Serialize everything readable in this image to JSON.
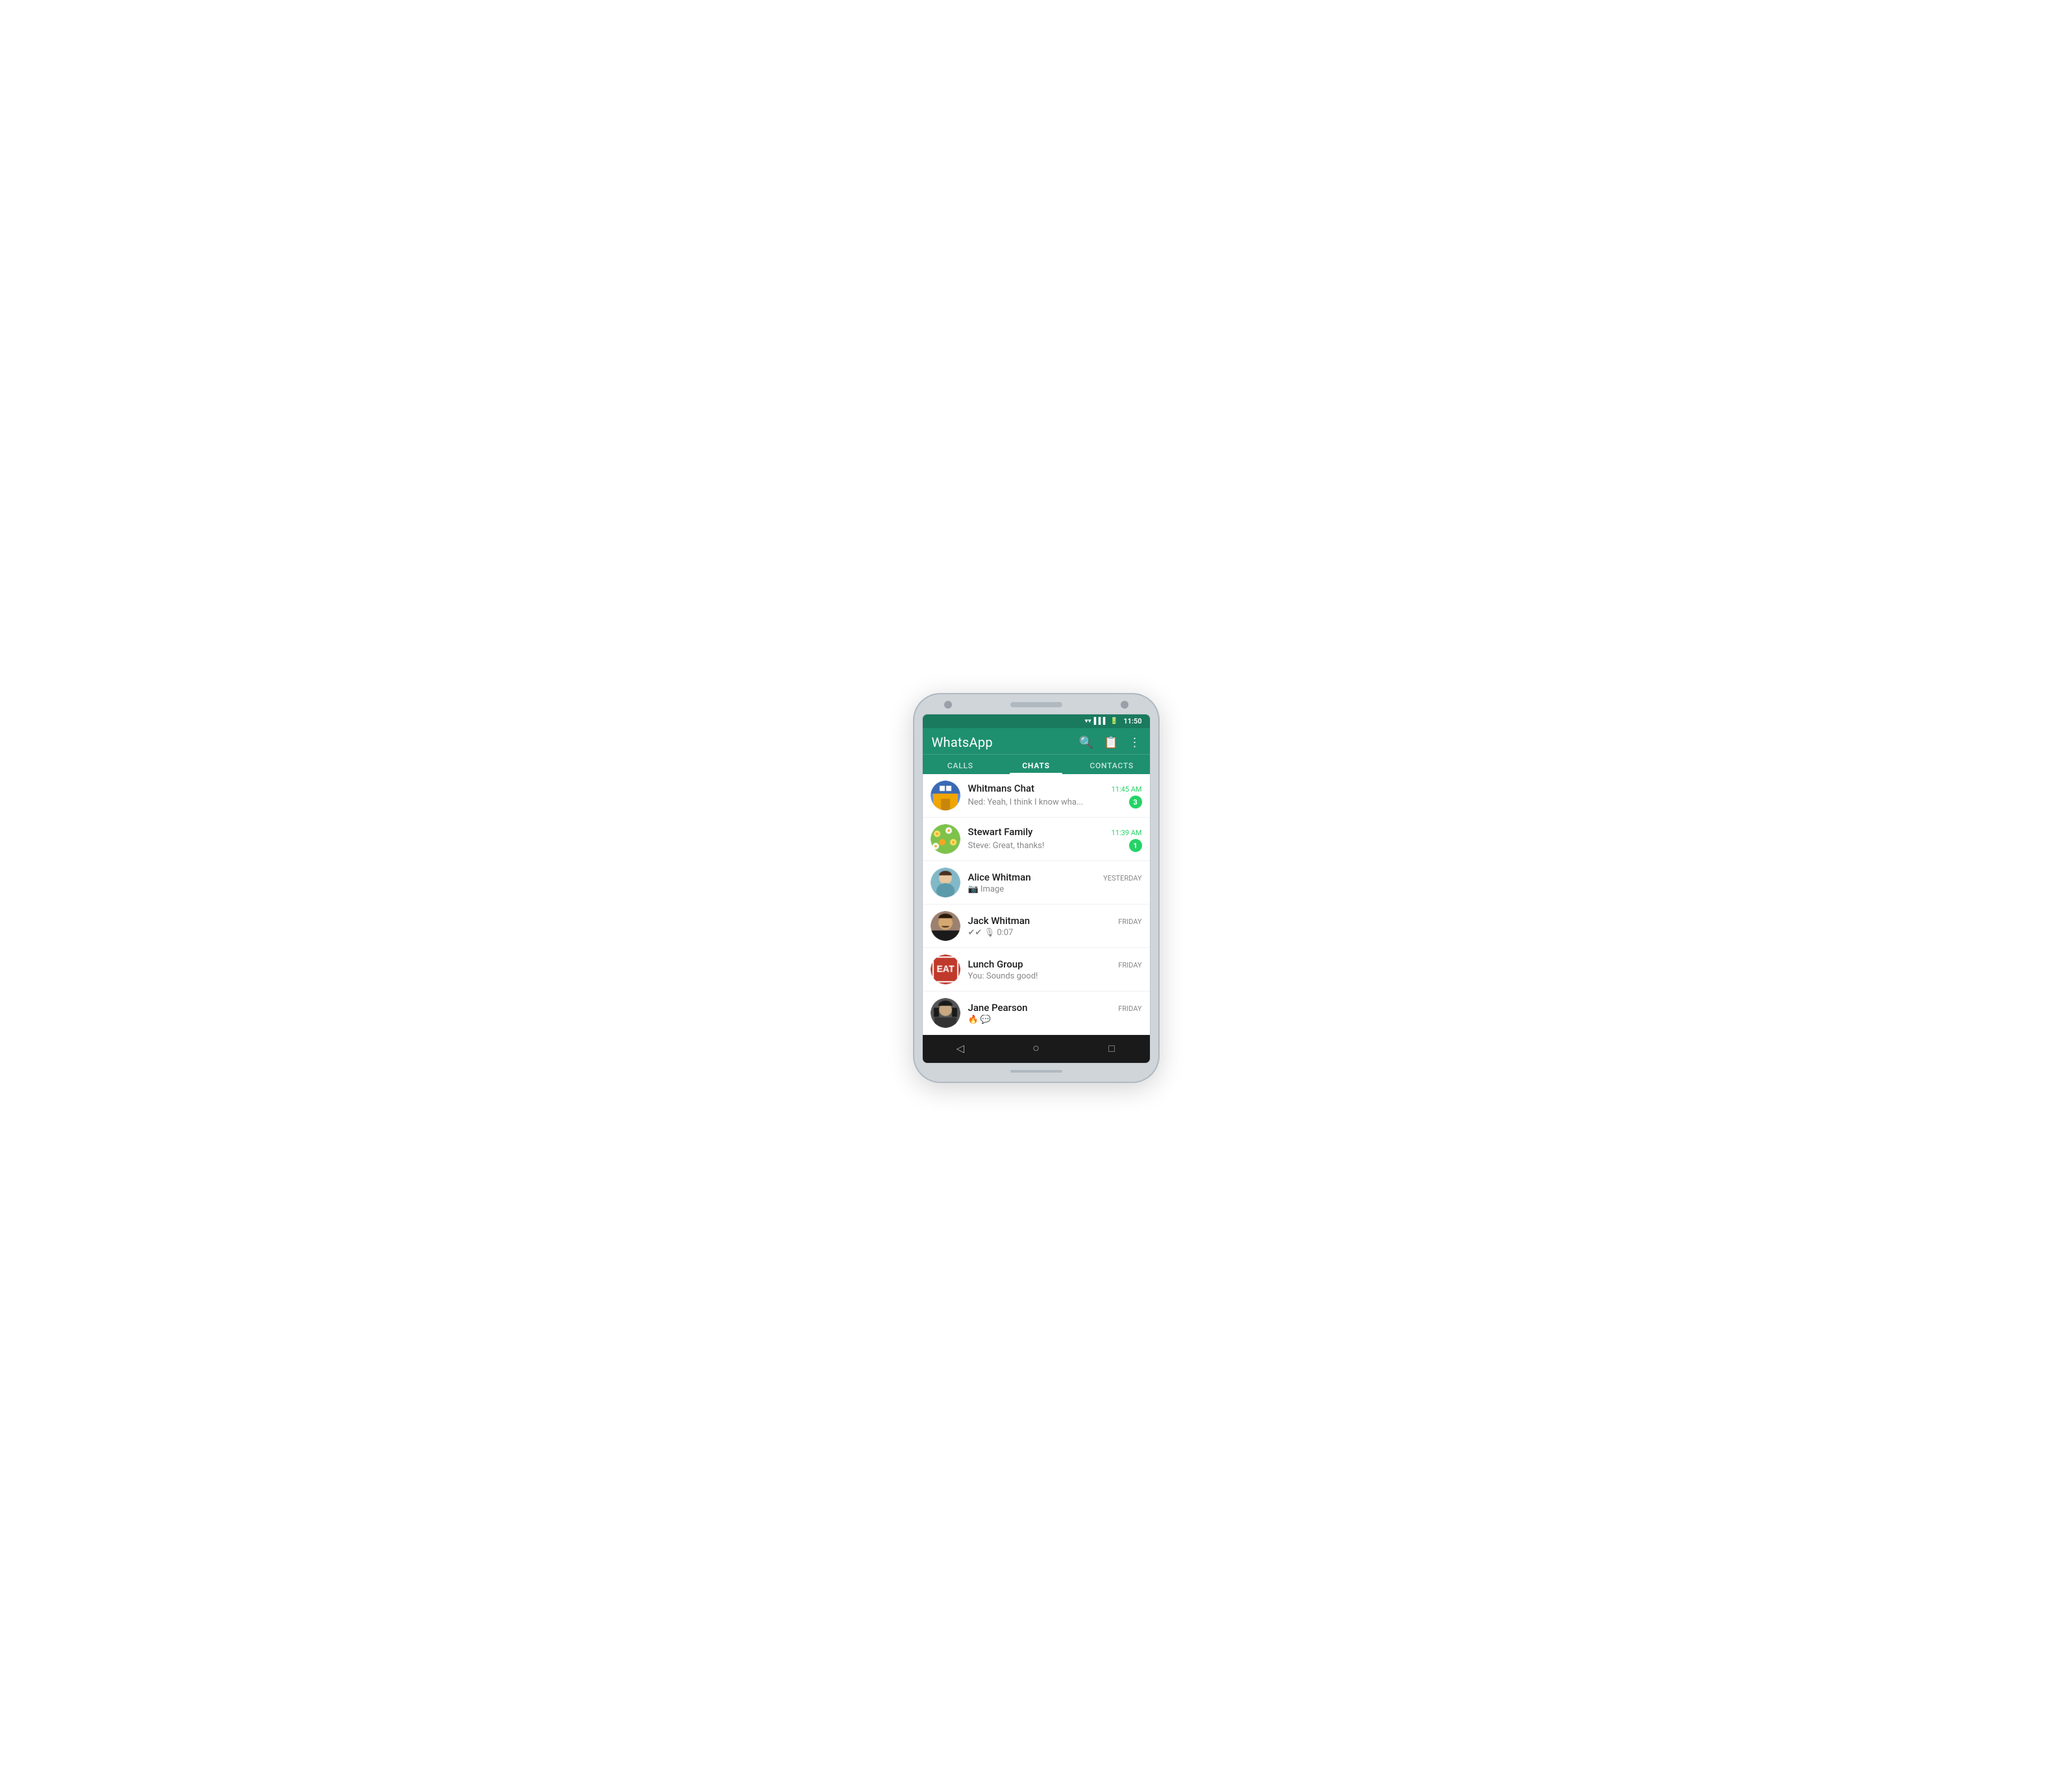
{
  "phone": {
    "status_time": "11:50",
    "app_title": "WhatsApp",
    "tabs": [
      {
        "id": "calls",
        "label": "CALLS",
        "active": false
      },
      {
        "id": "chats",
        "label": "CHATS",
        "active": true
      },
      {
        "id": "contacts",
        "label": "CONTACTS",
        "active": false
      }
    ],
    "search_icon": "search",
    "menu_icon": "clipboard",
    "more_icon": "more_vert",
    "chats": [
      {
        "id": "whitmans",
        "name": "Whitmans Chat",
        "preview": "Ned: Yeah, I think I know wha...",
        "time": "11:45 AM",
        "time_green": true,
        "badge": "3",
        "avatar_text": "🏠",
        "avatar_type": "whitmans"
      },
      {
        "id": "stewart",
        "name": "Stewart Family",
        "preview": "Steve: Great, thanks!",
        "time": "11:39 AM",
        "time_green": true,
        "badge": "1",
        "avatar_text": "🌼",
        "avatar_type": "stewart"
      },
      {
        "id": "alice",
        "name": "Alice Whitman",
        "preview": "📷 Image",
        "time": "YESTERDAY",
        "time_green": false,
        "badge": "",
        "avatar_type": "alice"
      },
      {
        "id": "jack",
        "name": "Jack Whitman",
        "preview": "✔✔ 🎙 0:07",
        "time": "FRIDAY",
        "time_green": false,
        "badge": "",
        "avatar_type": "jack"
      },
      {
        "id": "lunch",
        "name": "Lunch Group",
        "preview": "You: Sounds good!",
        "time": "FRIDAY",
        "time_green": false,
        "badge": "",
        "avatar_text": "EAT",
        "avatar_type": "lunch"
      },
      {
        "id": "jane",
        "name": "Jane Pearson",
        "preview": "🔥 💬",
        "time": "FRIDAY",
        "time_green": false,
        "badge": "",
        "avatar_type": "jane"
      }
    ]
  }
}
